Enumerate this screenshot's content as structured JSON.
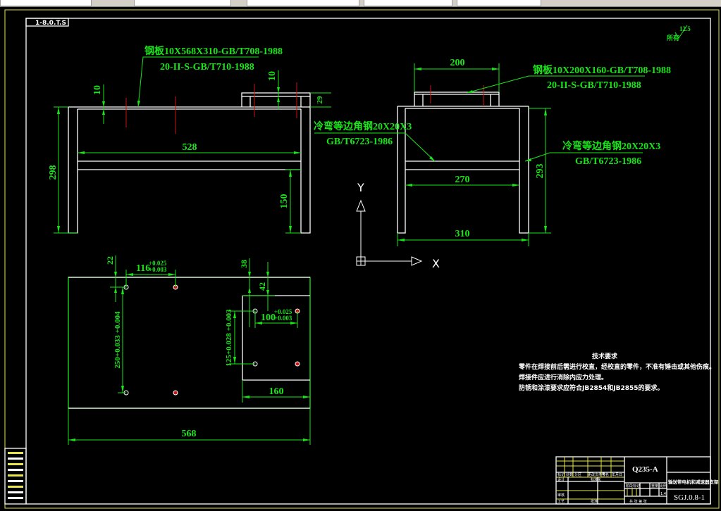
{
  "frame": {
    "stamp": "1-8.0.T.S"
  },
  "roughness": {
    "value": "12.5",
    "label": "所有"
  },
  "front_view": {
    "plate_note": "钢板10X568X310-GB/T708-1988",
    "weld_note": "20-II-S-GB/T710-1988",
    "dims": {
      "height": "298",
      "span": "528",
      "crossbar_height": "150",
      "plate_thickness": "10",
      "raised_thickness": "10",
      "raised_height": "29"
    }
  },
  "side_view": {
    "plate_note": "钢板10X200X160-GB/T708-1988",
    "weld_note": "20-II-S-GB/T710-1988",
    "angle_note_left": "冷弯等边角钢20X20X3",
    "angle_std_left": "GB/T6723-1986",
    "angle_note_right": "冷弯等边角钢20X20X3",
    "angle_std_right": "GB/T6723-1986",
    "dims": {
      "top": "200",
      "inner": "270",
      "width": "310",
      "height": "293"
    }
  },
  "ucs": {
    "x": "X",
    "y": "Y"
  },
  "top_view": {
    "dims": {
      "length": "568",
      "plate_width": "160",
      "edge_a": "22",
      "hole_spacing_a": "116",
      "hole_spacing_a_tol_upper": "+0.025",
      "hole_spacing_a_tol_lower": "+0.003",
      "hole_spacing_b": "250+0.033 +0.004",
      "edge_b": "38",
      "edge_c": "42",
      "hole_spacing_c": "100",
      "hole_spacing_c_tol_upper": "+0.025",
      "hole_spacing_c_tol_lower": "+0.003",
      "hole_spacing_d": "125+0.028 +0.003"
    }
  },
  "tech_requirements": {
    "title": "技术要求",
    "lines": [
      "零件在焊接前后需进行校直，经校直的零件，不准有锤击或其他伤痕。",
      "焊接件应进行消除内应力处理。",
      "防锈和涂漆要求应符合JB2854和JB2855的要求。"
    ]
  },
  "title_block": {
    "material": "Q235-A",
    "drawing_title": "输送带电机和减速器支架",
    "drawing_number": "SGJ.0.8-1",
    "scale": "1:4",
    "labels": [
      "标记",
      "处数",
      "分区",
      "更改文件号",
      "签名",
      "年月日",
      "设计",
      "标准化",
      "审核",
      "工艺",
      "批准",
      "阶段标记",
      "重量",
      "比例"
    ],
    "sheet": "共 张 第 张"
  },
  "colors": {
    "dimension": "#19e619",
    "outline": "#ffffff",
    "center": "#c81414",
    "border": "#e6e64a",
    "background": "#000000"
  }
}
